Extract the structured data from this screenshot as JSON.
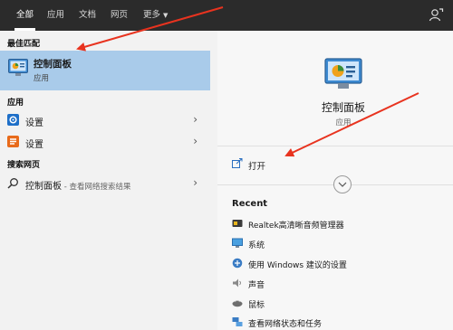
{
  "tabs": [
    {
      "label": "全部",
      "active": true
    },
    {
      "label": "应用",
      "active": false
    },
    {
      "label": "文档",
      "active": false
    },
    {
      "label": "网页",
      "active": false
    },
    {
      "label": "更多",
      "active": false
    }
  ],
  "tabs_more_caret": "▼",
  "feedback_icon": "feedback-person-icon",
  "left": {
    "best_match_heading": "最佳匹配",
    "best_match": {
      "title": "控制面板",
      "subtitle": "应用",
      "icon": "control-panel-icon"
    },
    "apps_heading": "应用",
    "apps": [
      {
        "label": "设置",
        "icon": "gear-icon"
      },
      {
        "label": "设置",
        "icon": "settings-orange-icon"
      }
    ],
    "web_heading": "搜索网页",
    "web_result": {
      "label": "控制面板",
      "suffix": " - 查看网络搜索结果",
      "icon": "search-icon"
    },
    "chevron": "›"
  },
  "right": {
    "title": "控制面板",
    "type": "应用",
    "open_label": "打开",
    "recent_heading": "Recent",
    "recent": [
      {
        "label": "Realtek高清晰音频管理器",
        "icon": "audio-manager-icon"
      },
      {
        "label": "系统",
        "icon": "system-icon"
      },
      {
        "label": "使用 Windows 建议的设置",
        "icon": "windows-settings-icon"
      },
      {
        "label": "声音",
        "icon": "speaker-icon"
      },
      {
        "label": "鼠标",
        "icon": "mouse-icon"
      },
      {
        "label": "查看网络状态和任务",
        "icon": "network-icon"
      }
    ]
  },
  "colors": {
    "topbar": "#2b2b2b",
    "selection": "#a9cbea",
    "annotation_arrow": "#e8331f"
  }
}
